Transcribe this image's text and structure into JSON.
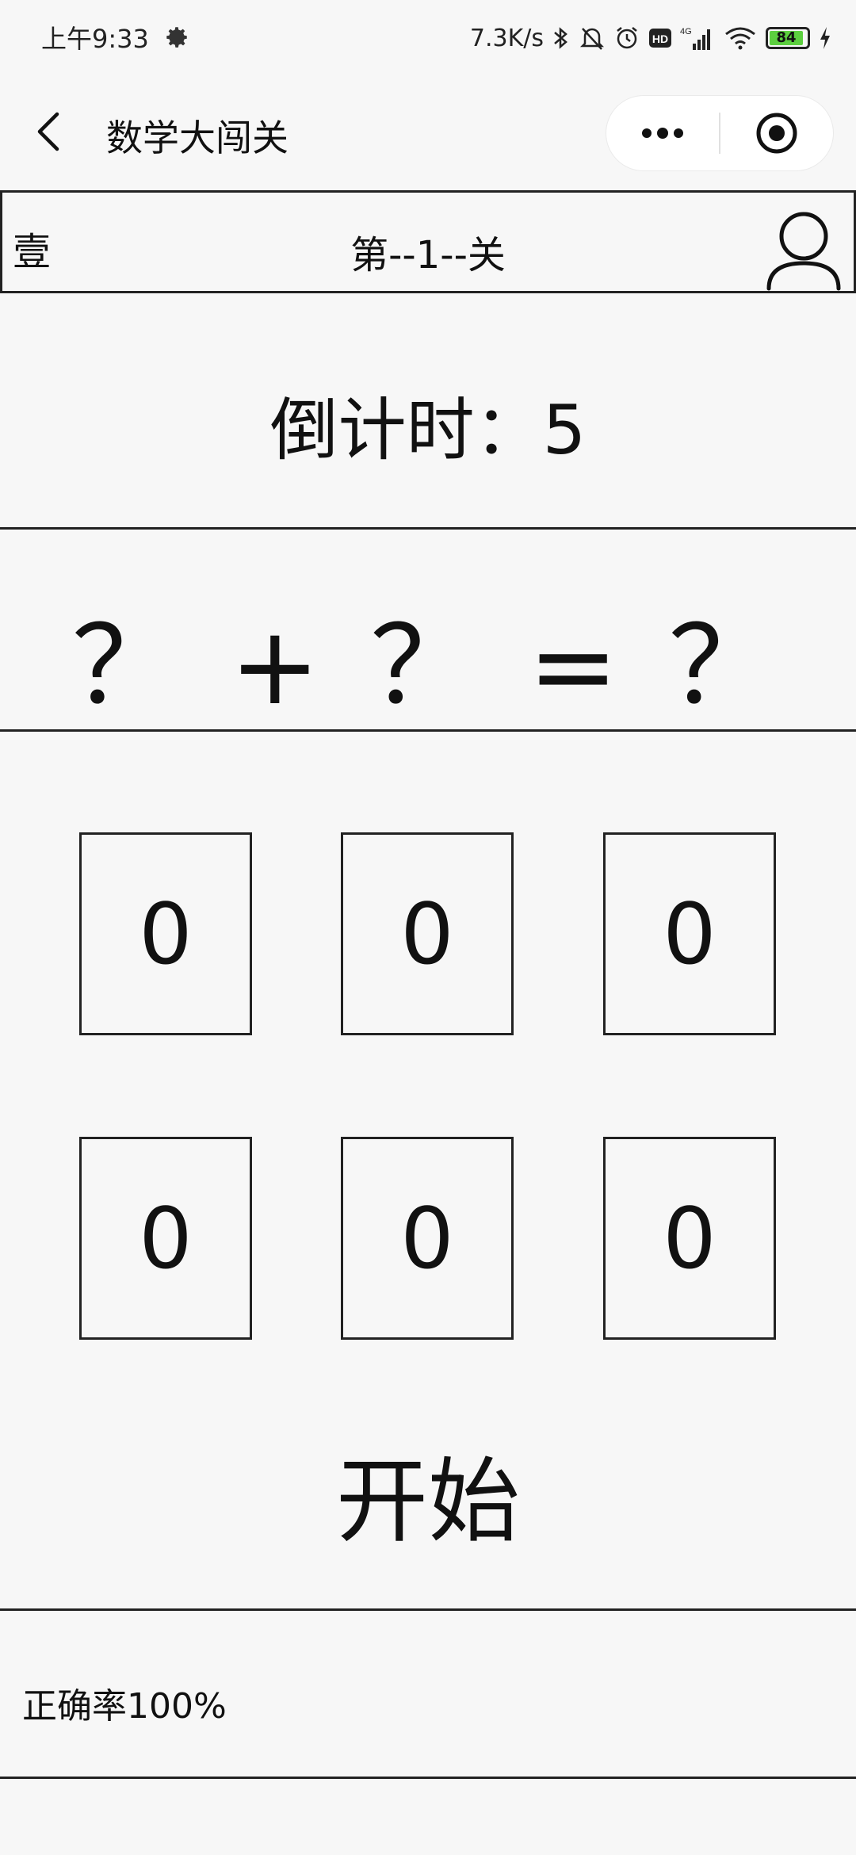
{
  "status_bar": {
    "time": "上午9:33",
    "network_speed": "7.3K/s",
    "battery_level": "84",
    "battery_color": "#5ccf3f",
    "icons": [
      "gear-icon",
      "bluetooth-icon",
      "mute-bell-icon",
      "alarm-icon",
      "hd-icon",
      "signal-4g-icon",
      "wifi-icon",
      "battery-icon",
      "charging-icon"
    ]
  },
  "nav": {
    "title": "数学大闯关"
  },
  "level_bar": {
    "left_label": "壹",
    "title": "第--1--关"
  },
  "countdown": {
    "text": "倒计时：5"
  },
  "equation": {
    "text": "？ + ？ = ？"
  },
  "cards": [
    "0",
    "0",
    "0",
    "0",
    "0",
    "0"
  ],
  "start_label": "开始",
  "accuracy": {
    "text": "正确率100%"
  }
}
